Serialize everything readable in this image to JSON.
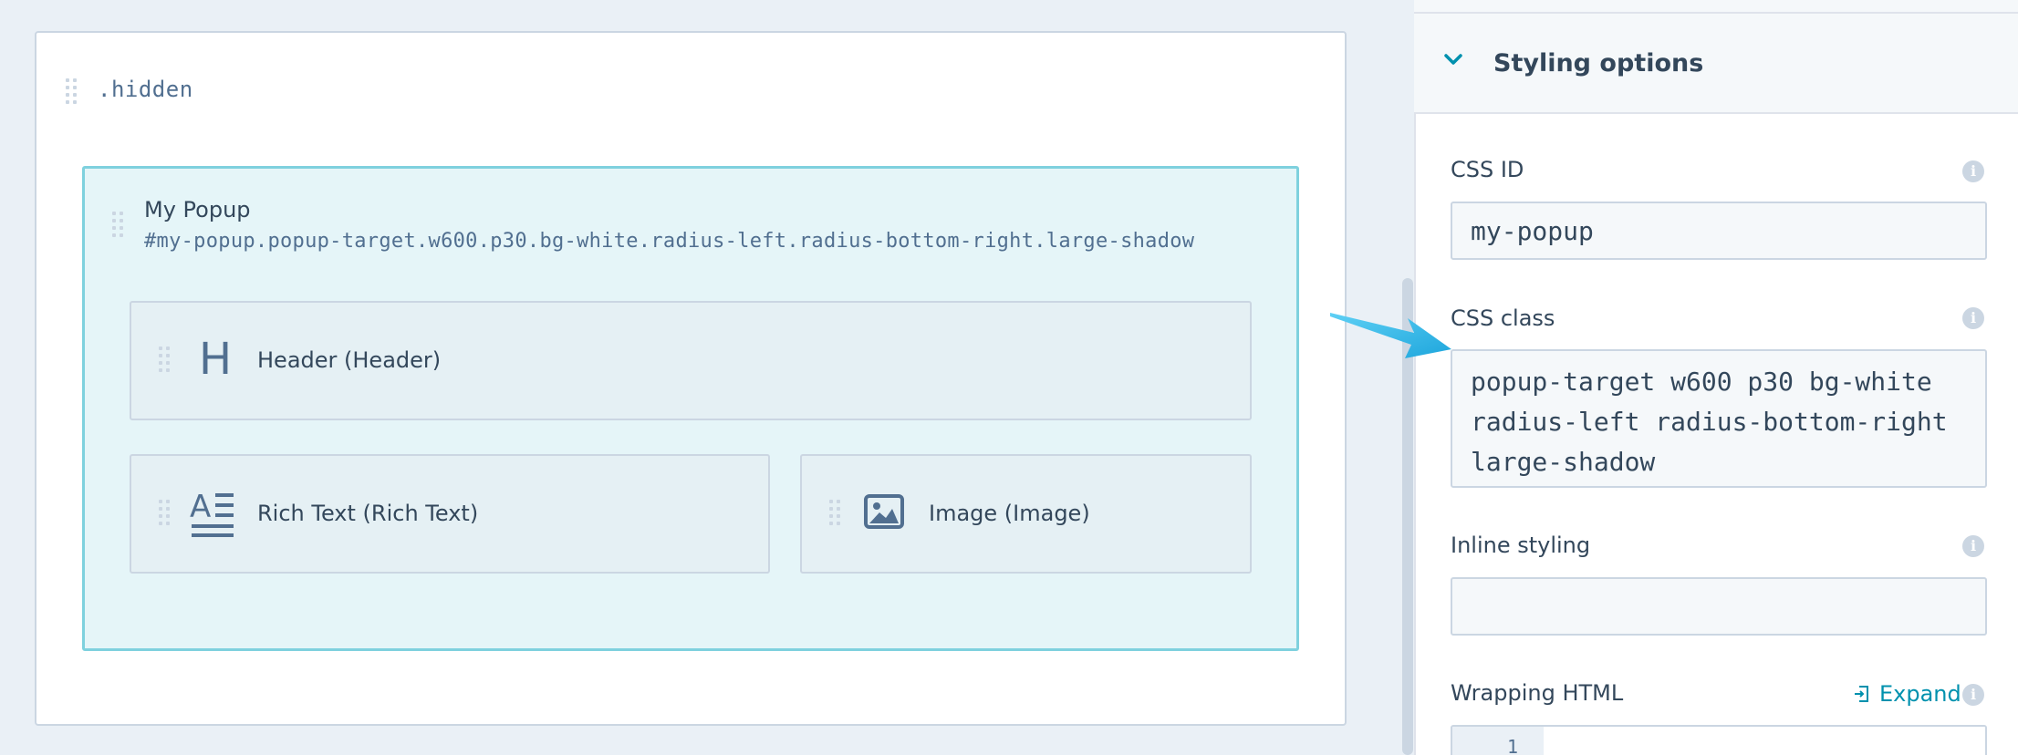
{
  "canvas": {
    "section_label": ".hidden",
    "popup": {
      "title": "My Popup",
      "class_path": "#my-popup.popup-target.w600.p30.bg-white.radius-left.radius-bottom-right.large-shadow"
    },
    "modules": [
      {
        "label": "Header (Header)",
        "icon": "header-icon"
      },
      {
        "label": "Rich Text (Rich Text)",
        "icon": "rich-text-icon"
      },
      {
        "label": "Image (Image)",
        "icon": "image-icon"
      }
    ]
  },
  "panel": {
    "section_title": "Styling options",
    "css_id": {
      "label": "CSS ID",
      "value": "my-popup"
    },
    "css_class": {
      "label": "CSS class",
      "value": "popup-target w600 p30 bg-white radius-left radius-bottom-right large-shadow"
    },
    "inline_styling": {
      "label": "Inline styling",
      "value": ""
    },
    "wrapping_html": {
      "label": "Wrapping HTML",
      "expand_label": "Expand",
      "line_number": "1"
    }
  },
  "colors": {
    "accent": "#0091ae",
    "popup_border": "#7fd1de",
    "popup_bg": "#e5f5f8",
    "arrow": "#2fb7e8"
  }
}
